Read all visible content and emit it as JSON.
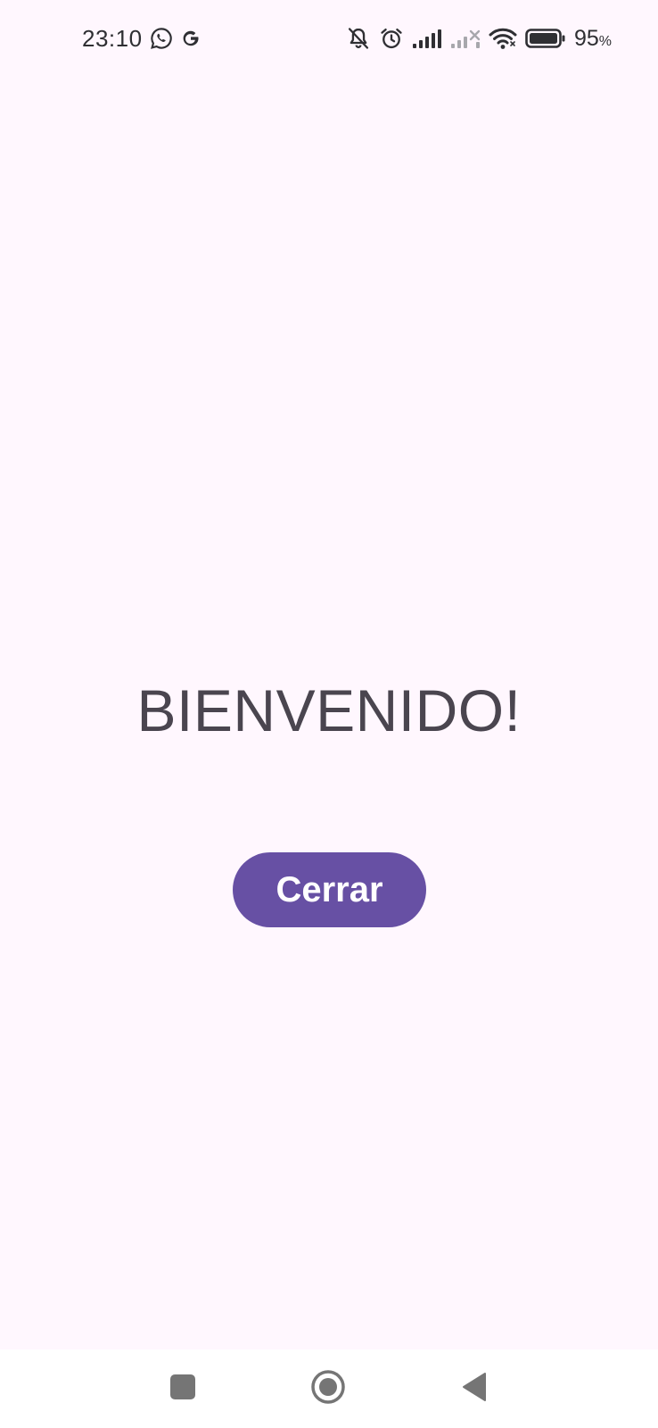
{
  "status_bar": {
    "time": "23:10",
    "left_icons": [
      "whatsapp-icon",
      "google-icon"
    ],
    "right_icons": [
      "bell-off-icon",
      "alarm-icon",
      "signal-icon",
      "signal-no-service-icon",
      "wifi-icon",
      "battery-icon"
    ],
    "battery_value": "95",
    "battery_unit": "%",
    "battery_level": 0.95
  },
  "main": {
    "title": "BIENVENIDO!",
    "close_button_label": "Cerrar"
  },
  "nav_bar": {
    "buttons": [
      "recents-icon",
      "home-icon",
      "back-icon"
    ]
  },
  "colors": {
    "background": "#fff7fe",
    "accent": "#6750a4",
    "text": "#4a454f",
    "nav_background": "#ffffff"
  }
}
